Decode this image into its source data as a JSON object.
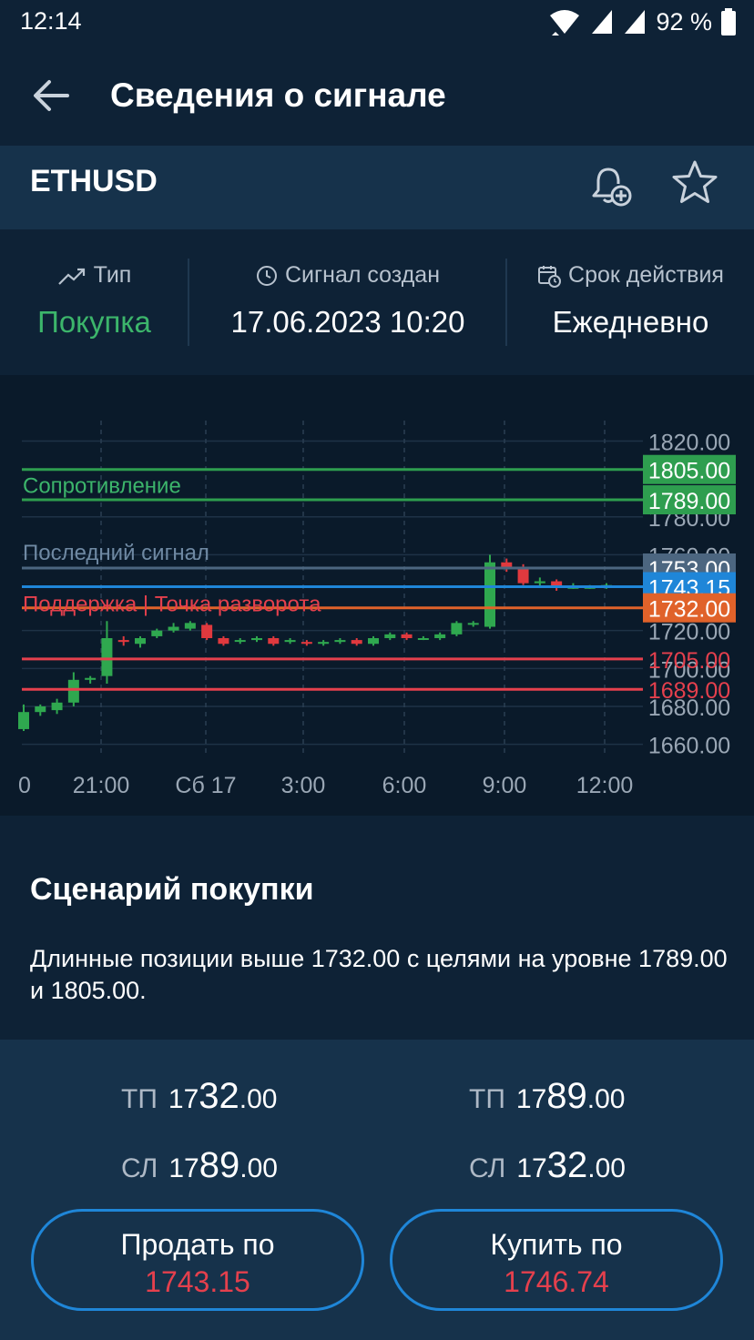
{
  "status_bar": {
    "time": "12:14",
    "battery": "92 %"
  },
  "header": {
    "title": "Сведения о сигнале"
  },
  "symbol": {
    "name": "ETHUSD"
  },
  "info": {
    "type_label": "Тип",
    "type_value": "Покупка",
    "created_label": "Сигнал создан",
    "created_value": "17.06.2023 10:20",
    "expiry_label": "Срок действия",
    "expiry_value": "Ежедневно"
  },
  "chart_data": {
    "type": "candlestick",
    "y_ticks": [
      "1820.00",
      "1780.00",
      "1760.00",
      "1720.00",
      "1700.00",
      "1680.00",
      "1660.00"
    ],
    "x_ticks": [
      "0",
      "21:00",
      "Сб 17",
      "3:00",
      "6:00",
      "9:00",
      "12:00"
    ],
    "ylim": [
      1655,
      1826
    ],
    "levels": [
      {
        "label": "Сопротивление",
        "value": 1805.0,
        "tag": "1805.00",
        "color": "#2e9e4f"
      },
      {
        "label": "",
        "value": 1789.0,
        "tag": "1789.00",
        "color": "#2e9e4f"
      },
      {
        "label": "Последний сигнал",
        "value": 1753.0,
        "tag": "1753.00",
        "color": "#4c6680"
      },
      {
        "label": "",
        "value": 1743.15,
        "tag": "1743.15",
        "color": "#1f86d8"
      },
      {
        "label": "Поддержка | Точка разворота",
        "value": 1732.0,
        "tag": "1732.00",
        "color": "#e0622a"
      },
      {
        "label": "",
        "value": 1705.0,
        "tag": "1705.00",
        "color": "#e5404d"
      },
      {
        "label": "",
        "value": 1689.0,
        "tag": "1689.00",
        "color": "#e5404d"
      }
    ],
    "candles": [
      [
        1668,
        1677,
        1681,
        1667
      ],
      [
        1677,
        1680,
        1681,
        1675
      ],
      [
        1678,
        1682,
        1684,
        1676
      ],
      [
        1682,
        1694,
        1698,
        1680
      ],
      [
        1694,
        1695,
        1696,
        1692
      ],
      [
        1696,
        1716,
        1725,
        1692
      ],
      [
        1715,
        1714,
        1717,
        1712
      ],
      [
        1713,
        1716,
        1717,
        1711
      ],
      [
        1717,
        1720,
        1721,
        1716
      ],
      [
        1720,
        1722,
        1724,
        1719
      ],
      [
        1721,
        1724,
        1725,
        1720
      ],
      [
        1723,
        1716,
        1724,
        1715
      ],
      [
        1716,
        1713,
        1717,
        1712
      ],
      [
        1715,
        1715,
        1716,
        1713
      ],
      [
        1715,
        1716,
        1717,
        1714
      ],
      [
        1716,
        1713,
        1717,
        1712
      ],
      [
        1714,
        1715,
        1716,
        1713
      ],
      [
        1714,
        1713,
        1715,
        1712
      ],
      [
        1713,
        1714,
        1715,
        1712
      ],
      [
        1714,
        1715,
        1716,
        1713
      ],
      [
        1715,
        1713,
        1716,
        1712
      ],
      [
        1713,
        1716,
        1717,
        1712
      ],
      [
        1716,
        1718,
        1719,
        1715
      ],
      [
        1718,
        1716,
        1719,
        1715
      ],
      [
        1716,
        1716,
        1717,
        1715
      ],
      [
        1716,
        1718,
        1719,
        1715
      ],
      [
        1718,
        1724,
        1725,
        1717
      ],
      [
        1724,
        1724,
        1725,
        1722
      ],
      [
        1722,
        1756,
        1760,
        1721
      ],
      [
        1756,
        1753,
        1758,
        1751
      ],
      [
        1753,
        1745,
        1755,
        1744
      ],
      [
        1745,
        1746,
        1748,
        1743
      ],
      [
        1746,
        1743,
        1747,
        1741
      ],
      [
        1743,
        1743,
        1745,
        1742
      ],
      [
        1743,
        1743,
        1744,
        1742
      ],
      [
        1743,
        1744,
        1745,
        1742
      ]
    ]
  },
  "scenario": {
    "title": "Сценарий покупки",
    "text": "Длинные позиции выше 1732.00 с целями на уровне 1789.00 и 1805.00."
  },
  "trade": {
    "left": {
      "tp_label": "ТП",
      "tp_a": "17",
      "tp_b": "32",
      "tp_c": ".00",
      "sl_label": "СЛ",
      "sl_a": "17",
      "sl_b": "89",
      "sl_c": ".00"
    },
    "right": {
      "tp_label": "ТП",
      "tp_a": "17",
      "tp_b": "89",
      "tp_c": ".00",
      "sl_label": "СЛ",
      "sl_a": "17",
      "sl_b": "32",
      "sl_c": ".00"
    },
    "sell_label": "Продать по",
    "sell_price": "1743.15",
    "buy_label": "Купить по",
    "buy_price": "1746.74"
  }
}
